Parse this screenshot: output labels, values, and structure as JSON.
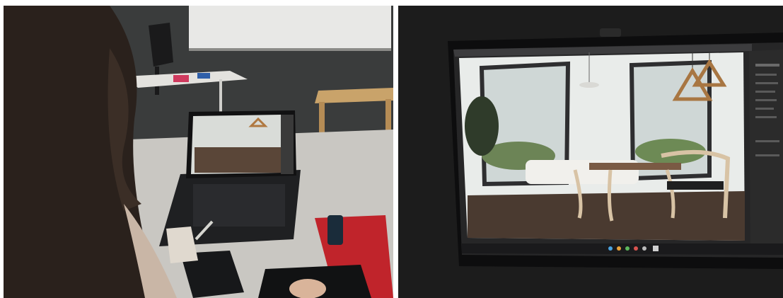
{
  "collage": {
    "left_photo": {
      "subject": "laptop-on-desk-showing-render"
    },
    "right_photo": {
      "subject": "monitor-closeup-showing-render"
    }
  },
  "colors": {
    "room_shadow": "#1c1c1c",
    "projector_screen": "#e8e8e6",
    "desk_surface": "#c9c7c2",
    "wood_bench": "#c9a36a",
    "hair": "#2a211c",
    "render_sky": "#e9ecea",
    "render_floor": "#4a3a30",
    "app_panel": "#2b2b2b",
    "red_pad": "#c0242b"
  }
}
